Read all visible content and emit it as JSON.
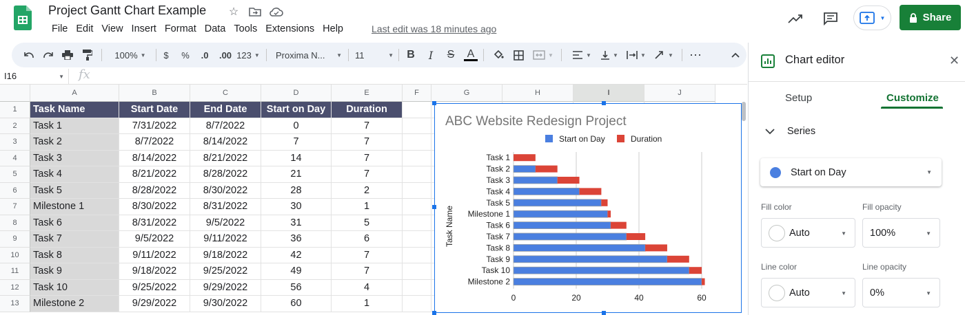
{
  "app": {
    "doc_title": "Project Gantt Chart Example",
    "menu": [
      "File",
      "Edit",
      "View",
      "Insert",
      "Format",
      "Data",
      "Tools",
      "Extensions",
      "Help"
    ],
    "last_edit": "Last edit was 18 minutes ago",
    "share_label": "Share",
    "brand_color": "#188038"
  },
  "toolbar": {
    "zoom": "100%",
    "currency": "$",
    "percent": "%",
    "dec_less": ".0",
    "dec_more": ".00",
    "format_more": "123",
    "font": "Proxima N...",
    "font_size": "11",
    "bold": "B",
    "italic": "I",
    "strike": "S",
    "text_color": "A",
    "more": "⋯"
  },
  "formula_bar": {
    "cell_ref": "I16",
    "fx": "fx"
  },
  "sheet": {
    "columns": [
      "A",
      "B",
      "C",
      "D",
      "E",
      "F",
      "G",
      "H",
      "I",
      "J"
    ],
    "row_numbers": [
      "1",
      "2",
      "3",
      "4",
      "5",
      "6",
      "7",
      "8",
      "9",
      "10",
      "11",
      "12",
      "13"
    ],
    "header": [
      "Task Name",
      "Start Date",
      "End Date",
      "Start on Day",
      "Duration"
    ],
    "rows": [
      [
        "Task 1",
        "7/31/2022",
        "8/7/2022",
        "0",
        "7"
      ],
      [
        "Task 2",
        "8/7/2022",
        "8/14/2022",
        "7",
        "7"
      ],
      [
        "Task 3",
        "8/14/2022",
        "8/21/2022",
        "14",
        "7"
      ],
      [
        "Task 4",
        "8/21/2022",
        "8/28/2022",
        "21",
        "7"
      ],
      [
        "Task 5",
        "8/28/2022",
        "8/30/2022",
        "28",
        "2"
      ],
      [
        "Milestone 1",
        "8/30/2022",
        "8/31/2022",
        "30",
        "1"
      ],
      [
        "Task 6",
        "8/31/2022",
        "9/5/2022",
        "31",
        "5"
      ],
      [
        "Task 7",
        "9/5/2022",
        "9/11/2022",
        "36",
        "6"
      ],
      [
        "Task 8",
        "9/11/2022",
        "9/18/2022",
        "42",
        "7"
      ],
      [
        "Task 9",
        "9/18/2022",
        "9/25/2022",
        "49",
        "7"
      ],
      [
        "Task 10",
        "9/25/2022",
        "9/29/2022",
        "56",
        "4"
      ],
      [
        "Milestone 2",
        "9/29/2022",
        "9/30/2022",
        "60",
        "1"
      ]
    ],
    "header_color": "#4b4f6e",
    "task_col_color": "#d9d9d9"
  },
  "chart_data": {
    "type": "bar",
    "orientation": "horizontal",
    "stacked": true,
    "title": "ABC Website Redesign Project",
    "ylabel": "Task Name",
    "xlabel": "",
    "categories": [
      "Task 1",
      "Task 2",
      "Task 3",
      "Task 4",
      "Task 5",
      "Milestone 1",
      "Task 6",
      "Task 7",
      "Task 8",
      "Task 9",
      "Task 10",
      "Milestone 2"
    ],
    "series": [
      {
        "name": "Start on Day",
        "values": [
          0,
          7,
          14,
          21,
          28,
          30,
          31,
          36,
          42,
          49,
          56,
          60
        ],
        "color": "#4a7fe0"
      },
      {
        "name": "Duration",
        "values": [
          7,
          7,
          7,
          7,
          2,
          1,
          5,
          6,
          7,
          7,
          4,
          1
        ],
        "color": "#db4437"
      }
    ],
    "xlim": [
      0,
      60
    ],
    "xticks": [
      "0",
      "20",
      "40",
      "60"
    ],
    "legend": "top",
    "grid": true
  },
  "panel": {
    "title": "Chart editor",
    "tabs": [
      "Setup",
      "Customize"
    ],
    "active_tab": "Customize",
    "section": "Series",
    "series_selected": "Start on Day",
    "fill_color_label": "Fill color",
    "fill_color_value": "Auto",
    "fill_opacity_label": "Fill opacity",
    "fill_opacity_value": "100%",
    "line_color_label": "Line color",
    "line_color_value": "Auto",
    "line_opacity_label": "Line opacity",
    "line_opacity_value": "0%"
  }
}
